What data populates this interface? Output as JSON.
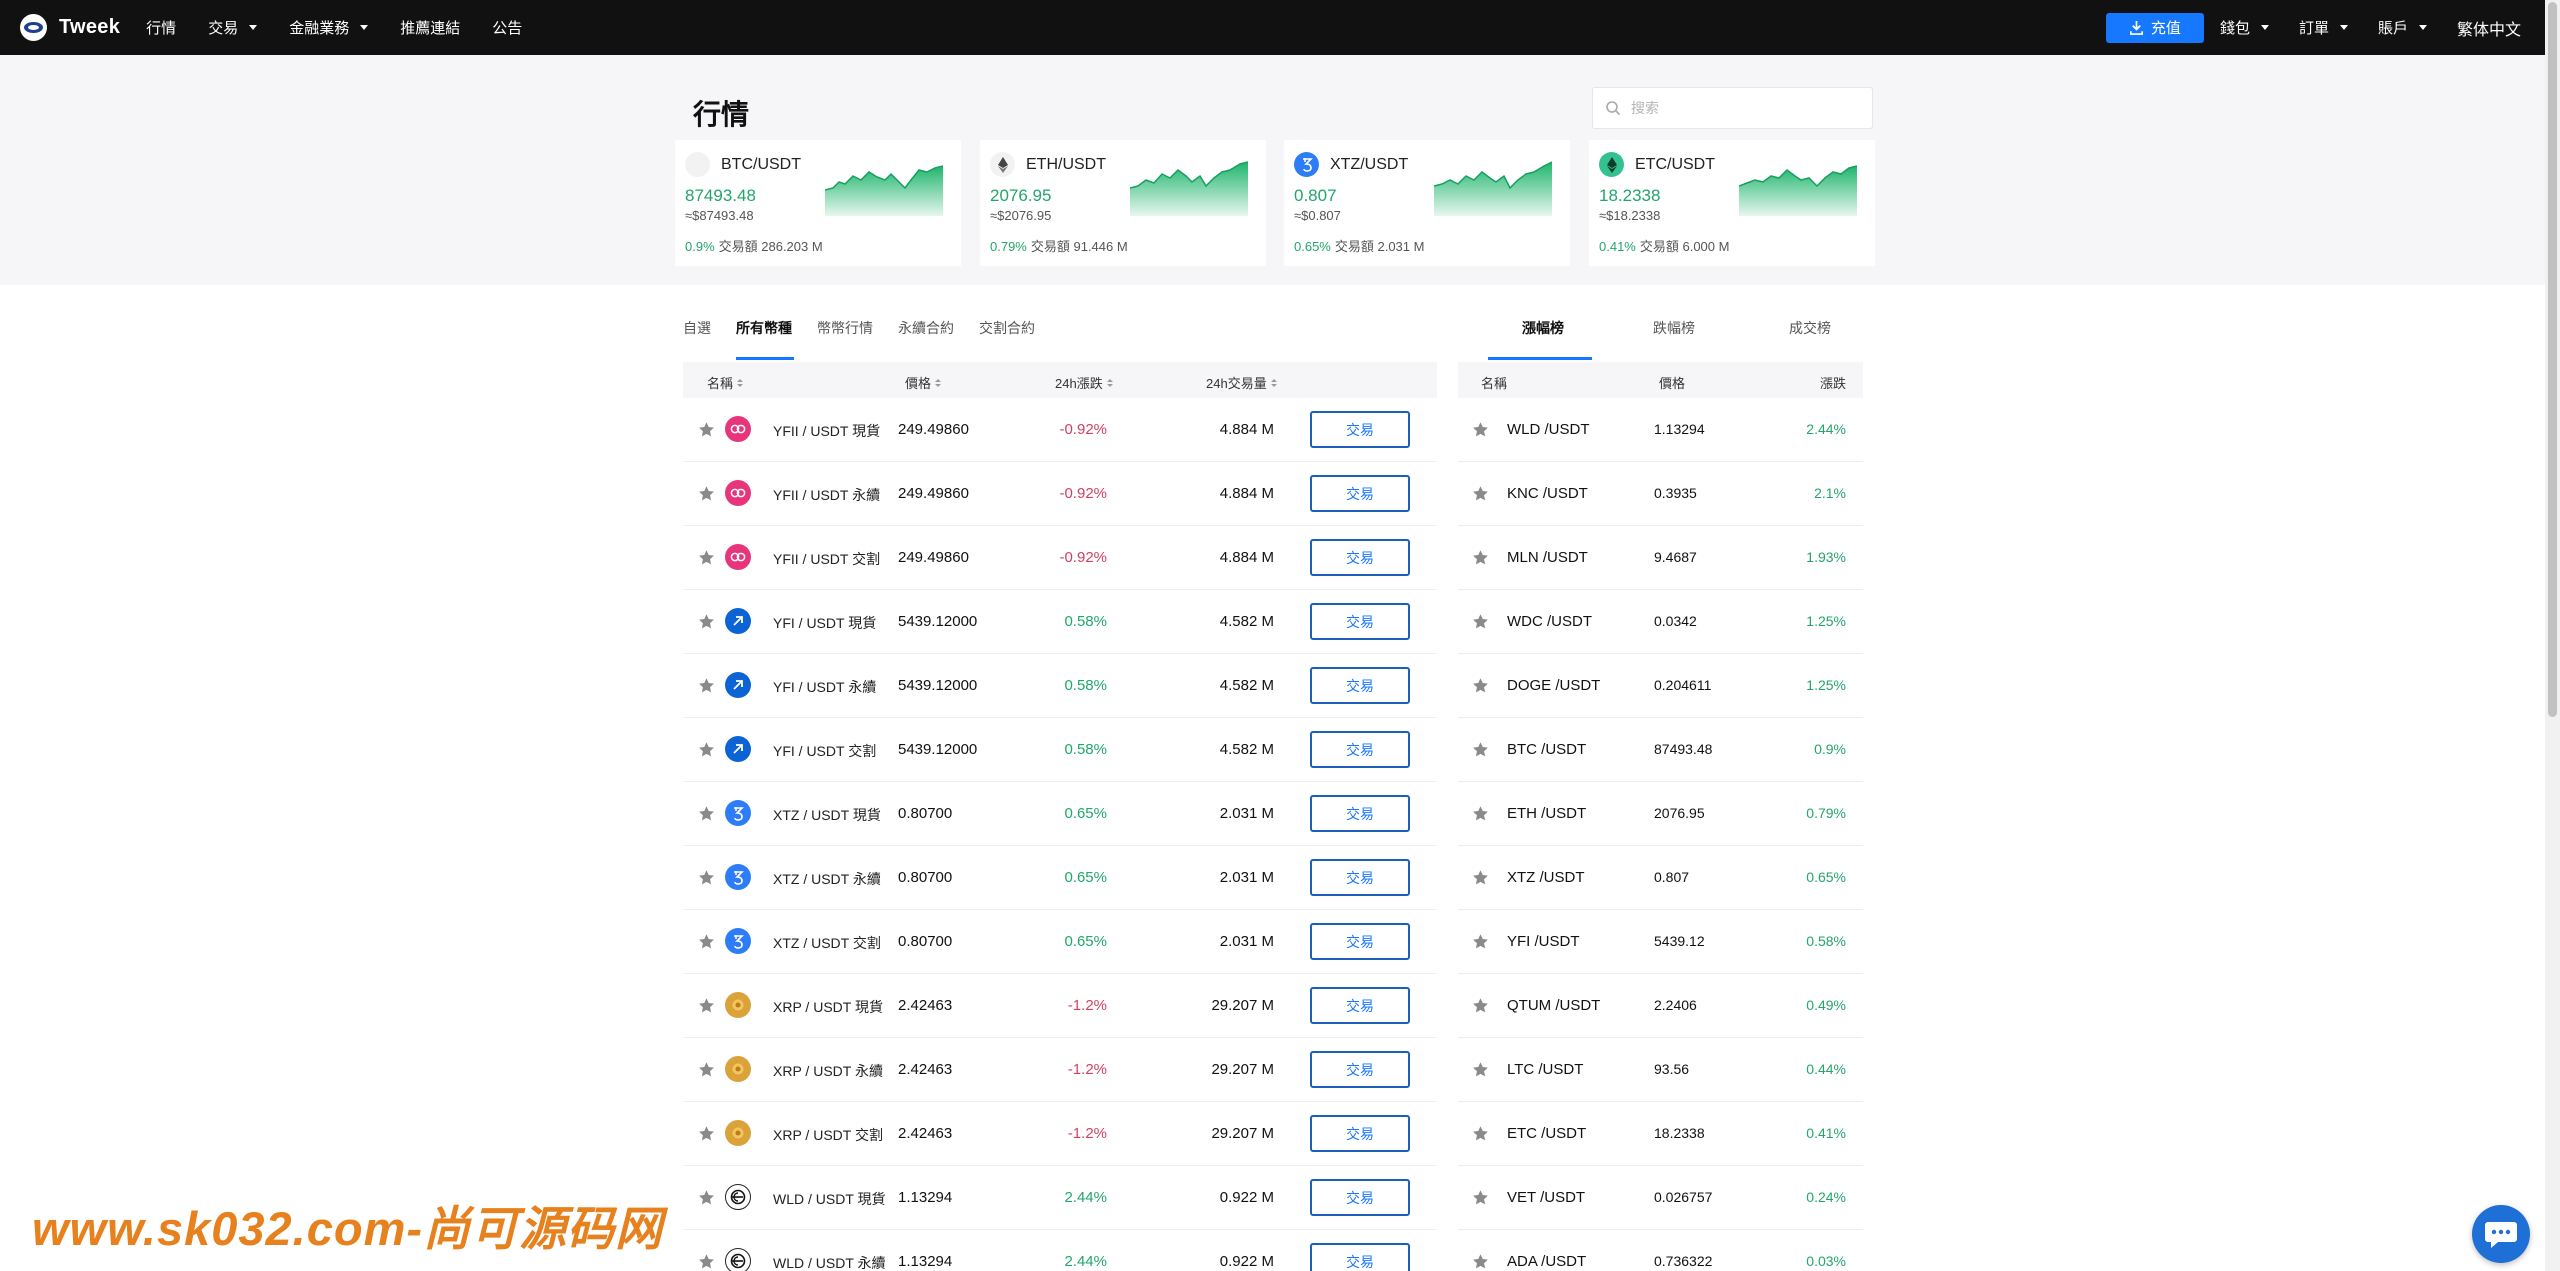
{
  "nav": {
    "brand": "Tweek",
    "links": [
      {
        "label": "行情",
        "caret": false
      },
      {
        "label": "交易",
        "caret": true
      },
      {
        "label": "金融業務",
        "caret": true
      },
      {
        "label": "推薦連結",
        "caret": false
      },
      {
        "label": "公告",
        "caret": false
      }
    ],
    "deposit": "充值",
    "wallet": "錢包",
    "orders": "訂單",
    "account": "賬戶",
    "language": "繁体中文"
  },
  "hero": {
    "title": "行情",
    "search_placeholder": "搜索",
    "cards": [
      {
        "pair": "BTC/USDT",
        "price": "87493.48",
        "approx": "≈$87493.48",
        "change": "0.9%",
        "volume": "交易額 286.203 M",
        "icon": "btc-icon"
      },
      {
        "pair": "ETH/USDT",
        "price": "2076.95",
        "approx": "≈$2076.95",
        "change": "0.79%",
        "volume": "交易額 91.446 M",
        "icon": "eth-icon"
      },
      {
        "pair": "XTZ/USDT",
        "price": "0.807",
        "approx": "≈$0.807",
        "change": "0.65%",
        "volume": "交易額 2.031 M",
        "icon": "xtz-icon"
      },
      {
        "pair": "ETC/USDT",
        "price": "18.2338",
        "approx": "≈$18.2338",
        "change": "0.41%",
        "volume": "交易額 6.000 M",
        "icon": "etc-icon"
      }
    ]
  },
  "tabs": {
    "main": [
      "自選",
      "所有幣種",
      "幣幣行情",
      "永續合約",
      "交割合約"
    ],
    "main_active": 1,
    "side": [
      "漲幅榜",
      "跌幅榜",
      "成交榜"
    ],
    "side_active": 0
  },
  "market": {
    "headers": {
      "name": "名稱",
      "price": "價格",
      "change": "24h漲跌",
      "volume": "24h交易量"
    },
    "trade_label": "交易",
    "rows": [
      {
        "name": "YFII / USDT 現貨",
        "price": "249.49860",
        "change": "-0.92%",
        "dir": "down",
        "volume": "4.884 M",
        "icon": "yfii"
      },
      {
        "name": "YFII / USDT 永續",
        "price": "249.49860",
        "change": "-0.92%",
        "dir": "down",
        "volume": "4.884 M",
        "icon": "yfii"
      },
      {
        "name": "YFII / USDT 交割",
        "price": "249.49860",
        "change": "-0.92%",
        "dir": "down",
        "volume": "4.884 M",
        "icon": "yfii"
      },
      {
        "name": "YFI / USDT 現貨",
        "price": "5439.12000",
        "change": "0.58%",
        "dir": "up",
        "volume": "4.582 M",
        "icon": "yfi"
      },
      {
        "name": "YFI / USDT 永續",
        "price": "5439.12000",
        "change": "0.58%",
        "dir": "up",
        "volume": "4.582 M",
        "icon": "yfi"
      },
      {
        "name": "YFI / USDT 交割",
        "price": "5439.12000",
        "change": "0.58%",
        "dir": "up",
        "volume": "4.582 M",
        "icon": "yfi"
      },
      {
        "name": "XTZ / USDT 現貨",
        "price": "0.80700",
        "change": "0.65%",
        "dir": "up",
        "volume": "2.031 M",
        "icon": "xtz"
      },
      {
        "name": "XTZ / USDT 永續",
        "price": "0.80700",
        "change": "0.65%",
        "dir": "up",
        "volume": "2.031 M",
        "icon": "xtz"
      },
      {
        "name": "XTZ / USDT 交割",
        "price": "0.80700",
        "change": "0.65%",
        "dir": "up",
        "volume": "2.031 M",
        "icon": "xtz"
      },
      {
        "name": "XRP / USDT 現貨",
        "price": "2.42463",
        "change": "-1.2%",
        "dir": "down",
        "volume": "29.207 M",
        "icon": "xrp"
      },
      {
        "name": "XRP / USDT 永續",
        "price": "2.42463",
        "change": "-1.2%",
        "dir": "down",
        "volume": "29.207 M",
        "icon": "xrp"
      },
      {
        "name": "XRP / USDT 交割",
        "price": "2.42463",
        "change": "-1.2%",
        "dir": "down",
        "volume": "29.207 M",
        "icon": "xrp"
      },
      {
        "name": "WLD / USDT 現貨",
        "price": "1.13294",
        "change": "2.44%",
        "dir": "up",
        "volume": "0.922 M",
        "icon": "wld"
      },
      {
        "name": "WLD / USDT 永續",
        "price": "1.13294",
        "change": "2.44%",
        "dir": "up",
        "volume": "0.922 M",
        "icon": "wld"
      }
    ]
  },
  "gainers": {
    "headers": {
      "name": "名稱",
      "price": "價格",
      "change": "漲跌"
    },
    "rows": [
      {
        "symbol": "WLD /USDT",
        "price": "1.13294",
        "change": "2.44%"
      },
      {
        "symbol": "KNC /USDT",
        "price": "0.3935",
        "change": "2.1%"
      },
      {
        "symbol": "MLN /USDT",
        "price": "9.4687",
        "change": "1.93%"
      },
      {
        "symbol": "WDC /USDT",
        "price": "0.0342",
        "change": "1.25%"
      },
      {
        "symbol": "DOGE /USDT",
        "price": "0.204611",
        "change": "1.25%"
      },
      {
        "symbol": "BTC /USDT",
        "price": "87493.48",
        "change": "0.9%"
      },
      {
        "symbol": "ETH /USDT",
        "price": "2076.95",
        "change": "0.79%"
      },
      {
        "symbol": "XTZ /USDT",
        "price": "0.807",
        "change": "0.65%"
      },
      {
        "symbol": "YFI /USDT",
        "price": "5439.12",
        "change": "0.58%"
      },
      {
        "symbol": "QTUM /USDT",
        "price": "2.2406",
        "change": "0.49%"
      },
      {
        "symbol": "LTC /USDT",
        "price": "93.56",
        "change": "0.44%"
      },
      {
        "symbol": "ETC /USDT",
        "price": "18.2338",
        "change": "0.41%"
      },
      {
        "symbol": "VET /USDT",
        "price": "0.026757",
        "change": "0.24%"
      },
      {
        "symbol": "ADA /USDT",
        "price": "0.736322",
        "change": "0.03%"
      }
    ]
  },
  "colors": {
    "accent": "#1677ff",
    "up": "#23a56b",
    "down": "#d3405e",
    "nav_bg": "#111111",
    "trade_border": "#1e5fb8"
  },
  "watermark": "www.sk032.com-尚可源码网"
}
